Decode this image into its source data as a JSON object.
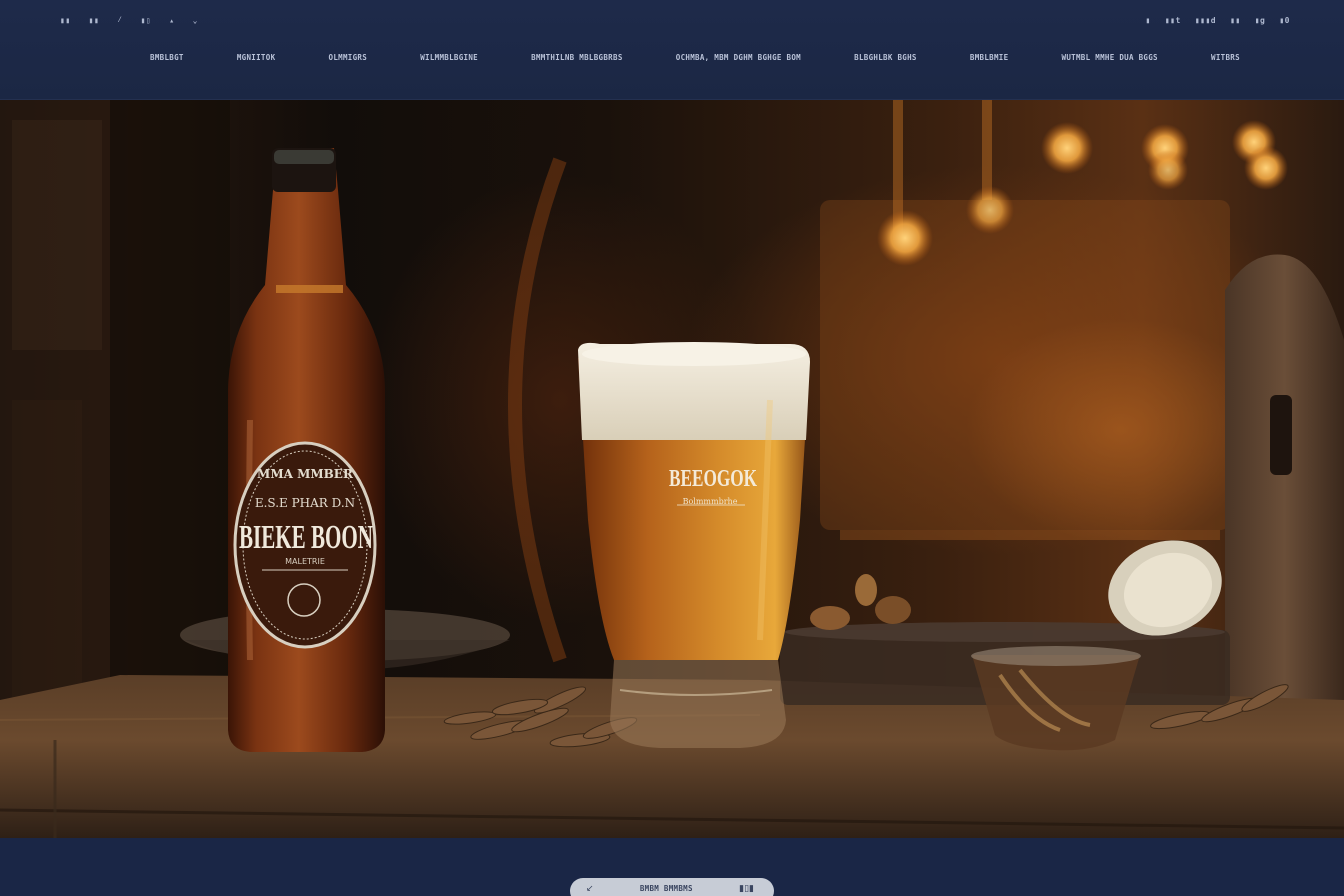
{
  "header": {
    "util_left": [
      "▮▮",
      "▮▮",
      "⁄",
      "▮▯",
      "▴",
      "⌄"
    ],
    "util_right": [
      "▮",
      "▮▮t",
      "▮▮▮d",
      "▮▮",
      "▮g",
      "▮0"
    ],
    "nav": [
      "BMBLBGT",
      "MGNIITOK",
      "OLMMIGRS",
      "WILMMBLBGINE",
      "BMMTHILNB MBLBGBRBS",
      "OCHMBA, MBM DGHM BGHGE BOM",
      "BLBGHLBK BGHS",
      "BMBLBMIE",
      "WUTMBL MMHE DUA BGGS",
      "WITBRS"
    ]
  },
  "hero": {
    "bottle_label": {
      "top_line": "MMA MMBER",
      "sub_line": "E.S.E PHAR D.N",
      "brand": "BIEKE BOON",
      "small_line": "MALETRIE"
    },
    "glass_label": {
      "brand": "BEEOGOK",
      "small_line": "Bolmmmbrhe"
    }
  },
  "footer": {
    "pill_left_icon": "↙",
    "pill_label": "BMBM BMMBMS",
    "pill_right_icon": "▮▯▮"
  },
  "colors": {
    "header_bg": "#1e2a4a",
    "footer_bg": "#1a2646",
    "pill_bg": "#c7ccd6",
    "beer_amber": "#c4741f",
    "foam": "#ece6d6"
  },
  "icons": {
    "util_left": [
      "grid-icon",
      "grid-icon",
      "slash-icon",
      "bars-icon",
      "caret-up-icon",
      "chevron-down-icon"
    ],
    "util_right": [
      "user-icon",
      "account-icon",
      "cart-icon",
      "bag-icon",
      "language-icon",
      "count-icon"
    ]
  }
}
